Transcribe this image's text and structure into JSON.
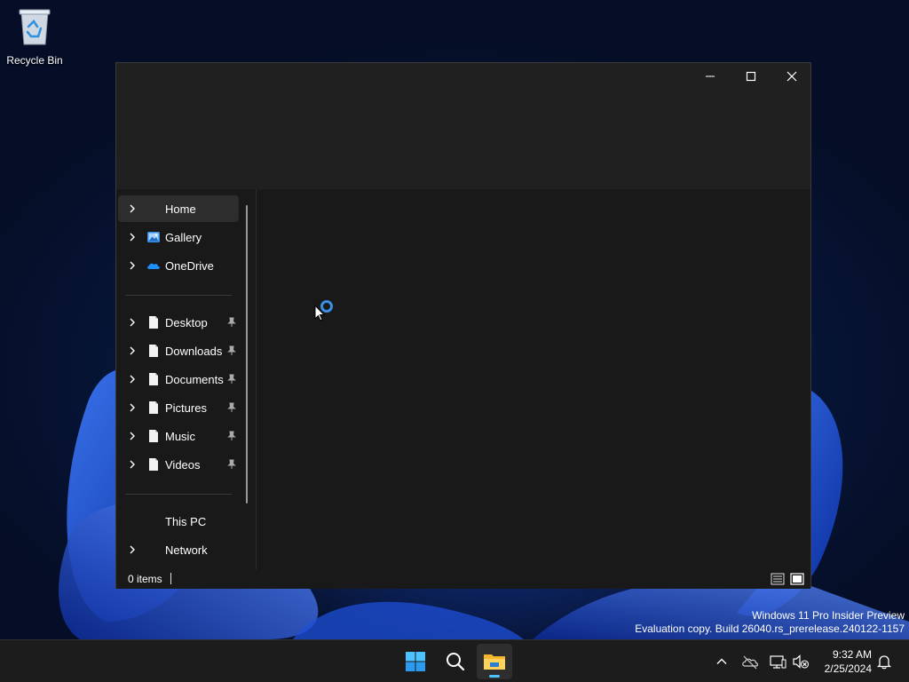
{
  "desktop": {
    "recycle_bin_label": "Recycle Bin",
    "watermark_line1": "Windows 11 Pro Insider Preview",
    "watermark_line2": "Evaluation copy. Build 26040.rs_prerelease.240122-1157"
  },
  "explorer": {
    "nav": {
      "items": [
        {
          "label": "Home",
          "icon": "home-icon",
          "selected": true
        },
        {
          "label": "Gallery",
          "icon": "gallery-icon"
        },
        {
          "label": "OneDrive",
          "icon": "onedrive-icon"
        },
        {
          "label": "Desktop",
          "icon": "file-icon",
          "pinned": true
        },
        {
          "label": "Downloads",
          "icon": "file-icon",
          "pinned": true
        },
        {
          "label": "Documents",
          "icon": "file-icon",
          "pinned": true
        },
        {
          "label": "Pictures",
          "icon": "file-icon",
          "pinned": true
        },
        {
          "label": "Music",
          "icon": "file-icon",
          "pinned": true
        },
        {
          "label": "Videos",
          "icon": "file-icon",
          "pinned": true
        },
        {
          "label": "This PC",
          "icon": "this-pc-icon"
        },
        {
          "label": "Network",
          "icon": "network-icon"
        }
      ]
    },
    "status": {
      "item_count": "0 items"
    }
  },
  "taskbar": {
    "time": "9:32 AM",
    "date": "2/25/2024"
  },
  "colors": {
    "accent": "#4cc2ff",
    "window_bg": "#191919",
    "titlebar_bg": "#202020",
    "taskbar_bg": "#1c1c1c"
  }
}
